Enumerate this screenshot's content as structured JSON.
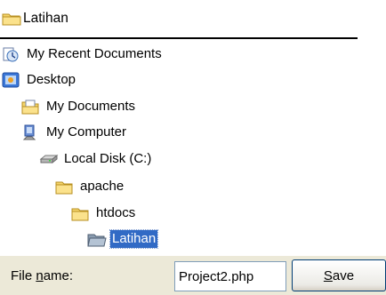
{
  "combo": {
    "current_folder": "Latihan",
    "icon": "folder-icon"
  },
  "tree": [
    {
      "label": "My Recent Documents",
      "icon": "recent-documents-icon",
      "level": 0
    },
    {
      "label": "Desktop",
      "icon": "desktop-icon",
      "level": 0
    },
    {
      "label": "My Documents",
      "icon": "my-documents-icon",
      "level": 1
    },
    {
      "label": "My Computer",
      "icon": "my-computer-icon",
      "level": 1
    },
    {
      "label": "Local Disk (C:)",
      "icon": "local-disk-icon",
      "level": 2
    },
    {
      "label": "apache",
      "icon": "folder-icon",
      "level": 3
    },
    {
      "label": "htdocs",
      "icon": "folder-icon",
      "level": 4
    },
    {
      "label": "Latihan",
      "icon": "folder-open-icon",
      "level": 5,
      "selected": true
    }
  ],
  "file_name": {
    "label_prefix": "File ",
    "label_accel": "n",
    "label_suffix": "ame:",
    "value": "Project2.php"
  },
  "save_button": {
    "accel": "S",
    "rest": "ave"
  },
  "colors": {
    "selection": "#316ac5",
    "dialog_bg": "#ece9d8",
    "folder": "#f5d56b"
  }
}
